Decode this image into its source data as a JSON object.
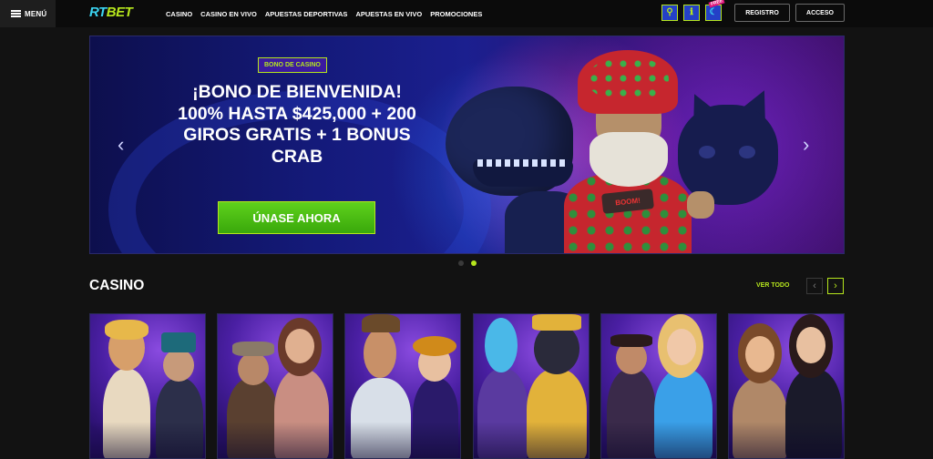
{
  "header": {
    "menu_label": "MENÚ",
    "logo_part1": "RT",
    "logo_part2": "BET",
    "nav": [
      "CASINO",
      "CASINO EN VIVO",
      "APUESTAS DEPORTIVAS",
      "APUESTAS EN VIVO",
      "PROMOCIONES"
    ],
    "icons": [
      "location-icon",
      "info-icon",
      "free-spin-icon"
    ],
    "free_tag": "FREE",
    "registro": "REGISTRO",
    "acceso": "ACCESO"
  },
  "banner": {
    "tag": "BONO DE CASINO",
    "headline": "¡BONO DE BIENVENIDA! 100% HASTA $425,000 + 200 GIROS GRATIS + 1 BONUS CRAB",
    "cta": "ÚNASE AHORA",
    "shirt_text": "BOOM!",
    "slides": 2,
    "active_slide": 2
  },
  "casino": {
    "title": "CASINO",
    "see_all": "VER TODO",
    "games": [
      {
        "theme": "goddess-and-magician"
      },
      {
        "theme": "adventurer-and-lady"
      },
      {
        "theme": "detective-and-jester"
      },
      {
        "theme": "pharaoh-and-egyptian-cat"
      },
      {
        "theme": "cowboy-and-heroine"
      },
      {
        "theme": "live-dealers"
      }
    ]
  },
  "colors": {
    "accent": "#b6e61d",
    "cyan": "#3bd3f0",
    "button_green": "#4cbd14",
    "background": "#121212"
  }
}
